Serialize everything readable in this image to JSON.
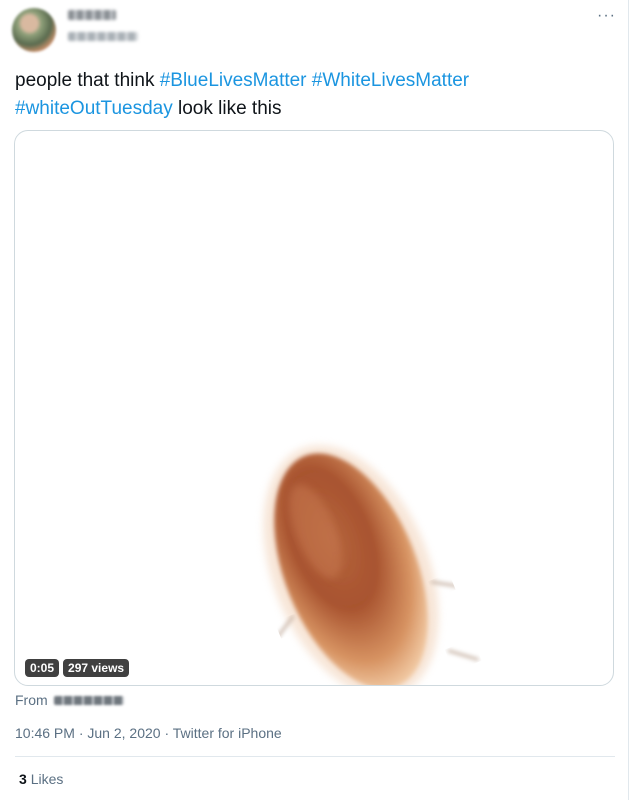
{
  "tweet": {
    "text_before": "people that think ",
    "hashtags": [
      "#BlueLivesMatter",
      "#WhiteLivesMatter",
      "#whiteOutTuesday"
    ],
    "text_after": " look like this",
    "more_label": "···"
  },
  "media": {
    "duration": "0:05",
    "views": "297 views"
  },
  "source": {
    "from_label": "From"
  },
  "meta": {
    "time": "10:46 PM",
    "date": "Jun 2, 2020",
    "client": "Twitter for iPhone",
    "separator": "·"
  },
  "stats": {
    "likes_count": "3",
    "likes_label": "Likes"
  },
  "colors": {
    "hashtag": "#1b95e0",
    "secondary_text": "#5b7083",
    "border": "#cfd9de"
  }
}
